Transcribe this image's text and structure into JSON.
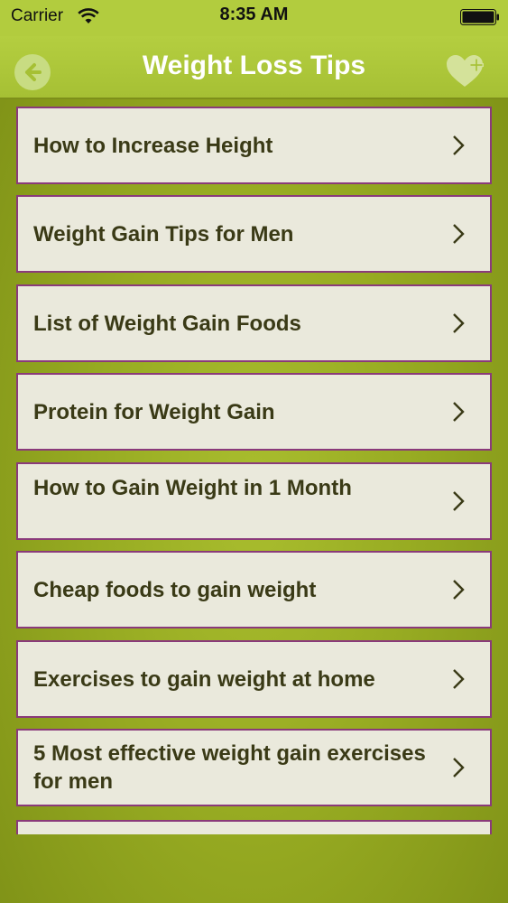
{
  "status_bar": {
    "carrier": "Carrier",
    "time": "8:35 AM"
  },
  "nav": {
    "title": "Weight Loss Tips",
    "back_icon": "back-arrow-icon",
    "favorite_icon": "heart-plus-icon"
  },
  "colors": {
    "nav_bar": "#b4ce40",
    "item_background": "#eae9dc",
    "item_border": "#8a3a7a",
    "item_text": "#3a3a16",
    "page_background": "#97ab22"
  },
  "items": [
    {
      "label": "How to Increase Height"
    },
    {
      "label": "Weight Gain Tips for Men"
    },
    {
      "label": "List of Weight Gain Foods"
    },
    {
      "label": "Protein for Weight Gain"
    },
    {
      "label": "How to Gain Weight in 1 Month"
    },
    {
      "label": "Cheap foods to gain weight"
    },
    {
      "label": "Exercises to gain weight at home"
    },
    {
      "label": "5 Most effective weight gain exercises for men"
    }
  ]
}
